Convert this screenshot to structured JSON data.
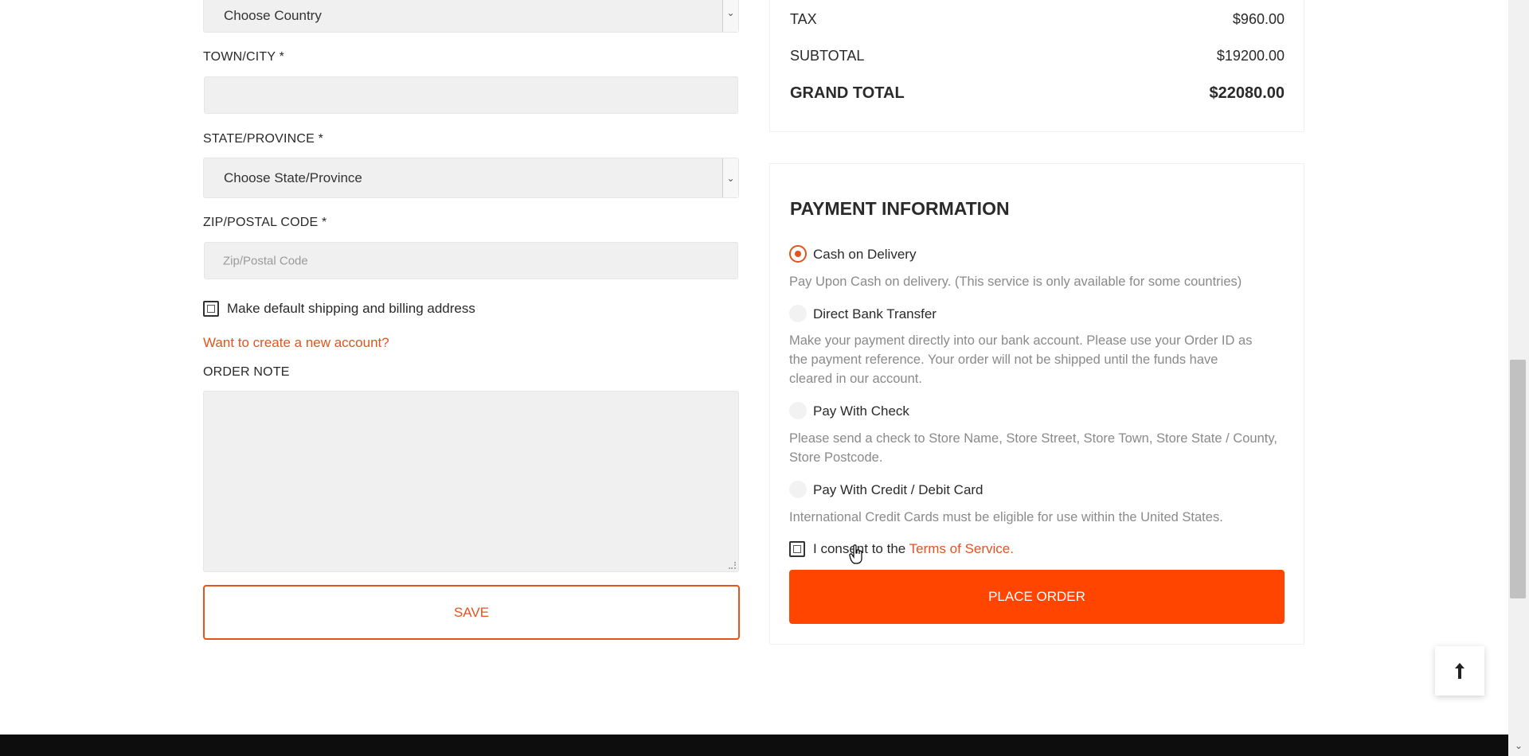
{
  "left_form": {
    "country_select": {
      "value": "Choose Country"
    },
    "town": {
      "label": "TOWN/CITY *",
      "value": ""
    },
    "state": {
      "label": "STATE/PROVINCE *",
      "value": "Choose State/Province"
    },
    "zip": {
      "label": "ZIP/POSTAL CODE *",
      "placeholder": "Zip/Postal Code"
    },
    "default_address": {
      "label": "Make default shipping and billing address",
      "checked": false
    },
    "create_account_link": "Want to create a new account?",
    "order_note": {
      "label": "ORDER NOTE",
      "value": ""
    },
    "save_button": "SAVE"
  },
  "order_summary": {
    "tax": {
      "label": "TAX",
      "value": "$960.00"
    },
    "subtotal": {
      "label": "SUBTOTAL",
      "value": "$19200.00"
    },
    "grand_total": {
      "label": "GRAND TOTAL",
      "value": "$22080.00"
    }
  },
  "payment": {
    "title": "PAYMENT INFORMATION",
    "options": [
      {
        "label": "Cash on Delivery",
        "selected": true,
        "description": "Pay Upon Cash on delivery. (This service is only available for some countries)"
      },
      {
        "label": "Direct Bank Transfer",
        "selected": false,
        "description": "Make your payment directly into our bank account. Please use your Order ID as the payment reference. Your order will not be shipped until the funds have cleared in our account."
      },
      {
        "label": "Pay With Check",
        "selected": false,
        "description": "Please send a check to Store Name, Store Street, Store Town, Store State / County, Store Postcode."
      },
      {
        "label": "Pay With Credit / Debit Card",
        "selected": false,
        "description": "International Credit Cards must be eligible for use within the United States."
      }
    ],
    "consent": {
      "prefix": "I consent to the ",
      "link": "Terms of Service.",
      "checked": false
    },
    "place_order_button": "PLACE ORDER"
  },
  "colors": {
    "accent": "#e2541e",
    "button": "#ff4500"
  },
  "scroll_top_icon": "arrow-up-icon"
}
